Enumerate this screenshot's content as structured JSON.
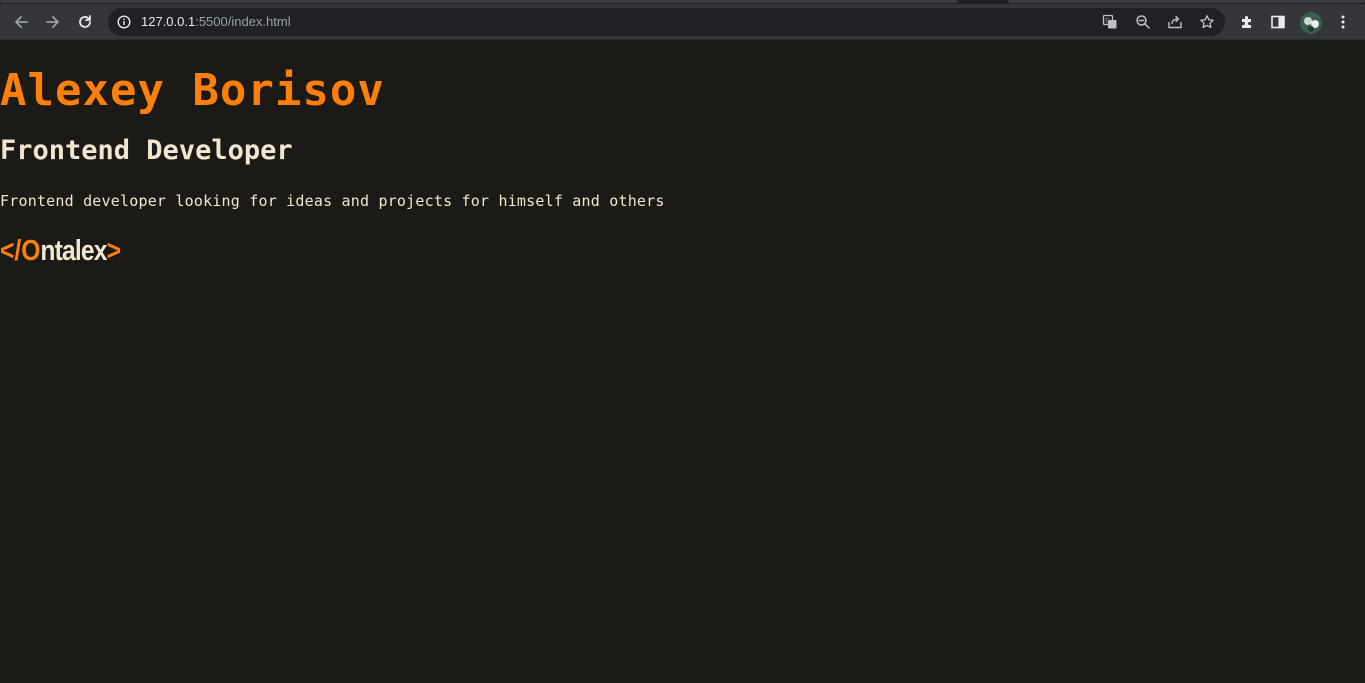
{
  "browser": {
    "url_host": "127.0.0.1",
    "url_rest": ":5500/index.html",
    "icons": [
      "back-icon",
      "forward-icon",
      "reload-icon",
      "info-icon",
      "translate-icon",
      "zoom-out-icon",
      "share-icon",
      "bookmark-star-icon",
      "extensions-icon",
      "side-panel-icon",
      "profile-avatar",
      "menu-kebab-icon"
    ]
  },
  "page": {
    "name": "Alexey Borisov",
    "role": "Frontend Developer",
    "bio": "Frontend developer looking for ideas and projects for himself and others",
    "logo": {
      "open": "</",
      "first": "O",
      "rest": "ntalex",
      "close": ">"
    }
  },
  "colors": {
    "background": "#1c1a17",
    "accent": "#ff7f0b",
    "text": "#f1e6cf",
    "chrome": "#35363a",
    "omnibox": "#202124"
  }
}
